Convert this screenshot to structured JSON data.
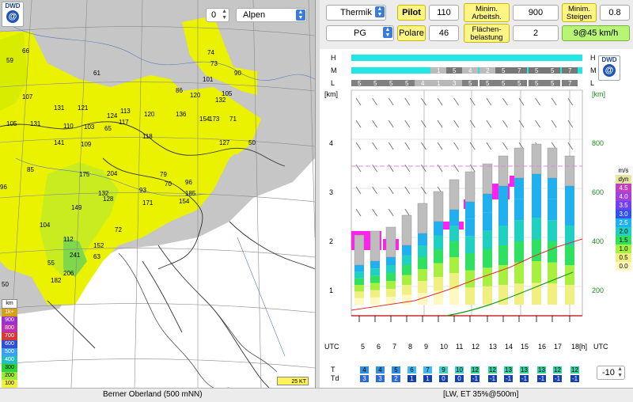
{
  "map": {
    "level_value": "0",
    "region": "Alpen",
    "brand": "DWD",
    "wind_legend": "25 KT",
    "legend_title": "km",
    "legend": [
      {
        "label": "1k+",
        "color": "#d4a017"
      },
      {
        "label": "900",
        "color": "#9b30d0"
      },
      {
        "label": "800",
        "color": "#c030a8"
      },
      {
        "label": "700",
        "color": "#d43a3a"
      },
      {
        "label": "600",
        "color": "#2f4fd8"
      },
      {
        "label": "500",
        "color": "#3aa0f0"
      },
      {
        "label": "400",
        "color": "#24c0c0"
      },
      {
        "label": "300",
        "color": "#2bd23a"
      },
      {
        "label": "200",
        "color": "#a0e838"
      },
      {
        "label": "100",
        "color": "#f0f040"
      }
    ],
    "values": [
      {
        "t": "66"
      },
      {
        "t": "61"
      },
      {
        "t": "59"
      },
      {
        "t": "107"
      },
      {
        "t": "131"
      },
      {
        "t": "121"
      },
      {
        "t": "105"
      },
      {
        "t": "131"
      },
      {
        "t": "124"
      },
      {
        "t": "113"
      },
      {
        "t": "120"
      },
      {
        "t": "85"
      },
      {
        "t": "110"
      },
      {
        "t": "103"
      },
      {
        "t": "136"
      },
      {
        "t": "105"
      },
      {
        "t": "154"
      },
      {
        "t": "173"
      },
      {
        "t": "71"
      },
      {
        "t": "141"
      },
      {
        "t": "109"
      },
      {
        "t": "118"
      },
      {
        "t": "117"
      },
      {
        "t": "127"
      },
      {
        "t": "50"
      },
      {
        "t": "65"
      },
      {
        "t": "175"
      },
      {
        "t": "204"
      },
      {
        "t": "79"
      },
      {
        "t": "96"
      },
      {
        "t": "132"
      },
      {
        "t": "93"
      },
      {
        "t": "70"
      },
      {
        "t": "185"
      },
      {
        "t": "149"
      },
      {
        "t": "128"
      },
      {
        "t": "171"
      },
      {
        "t": "154"
      },
      {
        "t": "104"
      },
      {
        "t": "72"
      },
      {
        "t": "112"
      },
      {
        "t": "241"
      },
      {
        "t": "63"
      },
      {
        "t": "55"
      },
      {
        "t": "206"
      },
      {
        "t": "182"
      },
      {
        "t": "50"
      },
      {
        "t": "74"
      },
      {
        "t": "73"
      },
      {
        "t": "101"
      },
      {
        "t": "90"
      },
      {
        "t": "86"
      },
      {
        "t": "132"
      },
      {
        "t": "96"
      },
      {
        "t": "152"
      },
      {
        "t": "120"
      }
    ]
  },
  "controls": {
    "thermik": "Thermik",
    "pilot": "Pilot",
    "pilot_value": "110",
    "min_arbeit_label": "Minim. Arbeitsh.",
    "min_arbeit_value": "900",
    "min_steigen_label": "Minim. Steigen",
    "min_steigen_value": "0.8",
    "glider": "PG",
    "polare": "Polare",
    "polare_value": "46",
    "flaechen_label": "Flächen-belastung",
    "flaechen_value": "2",
    "result": "9@45 km/h"
  },
  "meteogram": {
    "rows": [
      "H",
      "M",
      "L"
    ],
    "low_cloud": [
      "5",
      "5",
      "5",
      "5",
      "4",
      "1",
      "3",
      "5",
      "5",
      "5",
      "5",
      "5",
      "5",
      "7"
    ],
    "mid_cloud": [
      "",
      "",
      "",
      "",
      "",
      "1",
      "5",
      "4",
      "2",
      "5",
      "7",
      "5",
      "5",
      "7"
    ],
    "axis_km": [
      "[km]",
      "4",
      "3",
      "2",
      "1"
    ],
    "axis_m": [
      "[km]",
      "800",
      "600",
      "400",
      "200"
    ],
    "hours": [
      "5",
      "6",
      "7",
      "8",
      "9",
      "10",
      "11",
      "12",
      "13",
      "14",
      "15",
      "16",
      "17",
      "18[h]"
    ],
    "utc": "UTC",
    "T_label": "T",
    "Td_label": "Td",
    "T": [
      "4",
      "4",
      "5",
      "6",
      "7",
      "9",
      "10",
      "12",
      "12",
      "13",
      "13",
      "13",
      "12",
      "12"
    ],
    "Td": [
      "3",
      "3",
      "2",
      "1",
      "1",
      "0",
      "0",
      "-1",
      "-1",
      "-1",
      "-1",
      "-1",
      "-1",
      "-1"
    ],
    "offset": "-10",
    "scale_title": "m/s",
    "scale": [
      {
        "label": "dyn",
        "color": "#e6e6a0"
      },
      {
        "label": "4.5",
        "color": "#c040c0"
      },
      {
        "label": "4.0",
        "color": "#a040e0"
      },
      {
        "label": "3.5",
        "color": "#7040f0"
      },
      {
        "label": "3.0",
        "color": "#3050f0"
      },
      {
        "label": "2.5",
        "color": "#20b0f0"
      },
      {
        "label": "2.0",
        "color": "#20d0c0"
      },
      {
        "label": "1.5",
        "color": "#30e060"
      },
      {
        "label": "1.0",
        "color": "#a8f040"
      },
      {
        "label": "0.5",
        "color": "#f0f080"
      },
      {
        "label": "0.0",
        "color": "#fff8c0"
      }
    ]
  },
  "status": {
    "left": "Berner Oberland (500 mNN)",
    "right": "[LW, ET  35%@500m]"
  }
}
